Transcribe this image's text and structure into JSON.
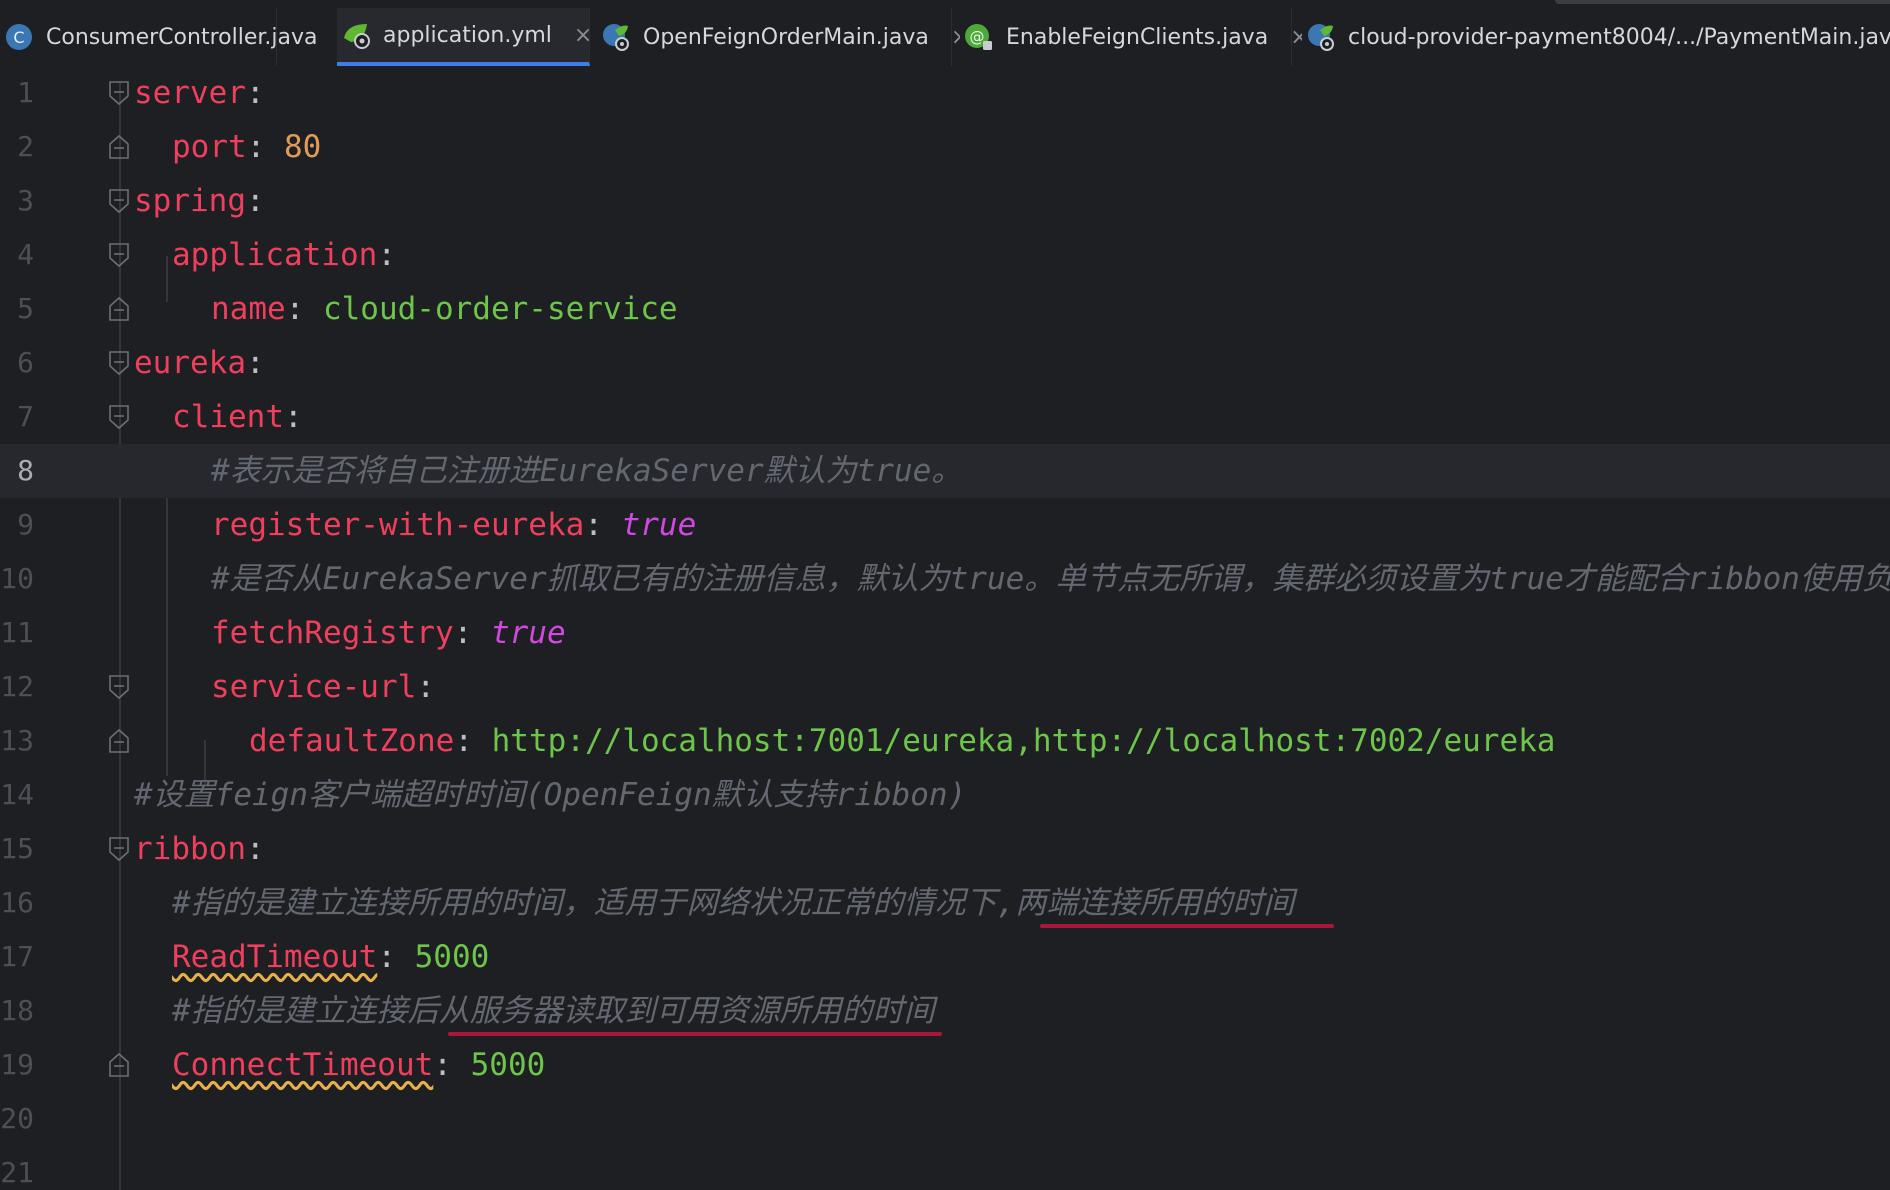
{
  "tabs": [
    {
      "label": "ConsumerController.java",
      "icon": "java-class-icon",
      "active": false
    },
    {
      "label": "application.yml",
      "icon": "spring-config-icon",
      "active": true
    },
    {
      "label": "OpenFeignOrderMain.java",
      "icon": "spring-boot-class-icon",
      "active": false
    },
    {
      "label": "EnableFeignClients.java",
      "icon": "annotation-icon",
      "active": false
    },
    {
      "label": "cloud-provider-payment8004/.../PaymentMain.java",
      "icon": "spring-boot-class-icon",
      "active": false
    }
  ],
  "close_glyph": "×",
  "colors": {
    "key": "#ee3f5c",
    "string": "#6dc54a",
    "number": "#e09a5c",
    "boolean": "#d048e0",
    "comment": "#636770",
    "active_tab_underline": "#3d7ee8",
    "highlight_underline": "#a8163a"
  },
  "editor": {
    "current_line": 8,
    "line_numbers": [
      "1",
      "2",
      "3",
      "4",
      "5",
      "6",
      "7",
      "8",
      "9",
      "10",
      "11",
      "12",
      "13",
      "14",
      "15",
      "16",
      "17",
      "18",
      "19",
      "20",
      "21"
    ],
    "lines": {
      "l1": {
        "key": "server",
        "sep": ":"
      },
      "l2": {
        "key": "port",
        "sep": ": ",
        "value": "80"
      },
      "l3": {
        "key": "spring",
        "sep": ":"
      },
      "l4": {
        "key": "application",
        "sep": ":"
      },
      "l5": {
        "key": "name",
        "sep": ": ",
        "value": "cloud-order-service"
      },
      "l6": {
        "key": "eureka",
        "sep": ":"
      },
      "l7": {
        "key": "client",
        "sep": ":"
      },
      "l8": {
        "comment": "#表示是否将自己注册进EurekaServer默认为true。"
      },
      "l9": {
        "key": "register-with-eureka",
        "sep": ": ",
        "value": "true"
      },
      "l10": {
        "comment": "#是否从EurekaServer抓取已有的注册信息，默认为true。单节点无所谓，集群必须设置为true才能配合ribbon使用负载均衡"
      },
      "l11": {
        "key": "fetchRegistry",
        "sep": ": ",
        "value": "true"
      },
      "l12": {
        "key": "service-url",
        "sep": ":"
      },
      "l13": {
        "key": "defaultZone",
        "sep": ": ",
        "value": "http://localhost:7001/eureka,http://localhost:7002/eureka"
      },
      "l14": {
        "comment": "#设置feign客户端超时时间(OpenFeign默认支持ribbon)"
      },
      "l15": {
        "key": "ribbon",
        "sep": ":"
      },
      "l16": {
        "comment": "#指的是建立连接所用的时间，适用于网络状况正常的情况下,两端连接所用的时间"
      },
      "l17": {
        "key": "ReadTimeout",
        "sep": ": ",
        "value": "5000"
      },
      "l18": {
        "comment": "#指的是建立连接后从服务器读取到可用资源所用的时间"
      },
      "l19": {
        "key": "ConnectTimeout",
        "sep": ": ",
        "value": "5000"
      }
    }
  }
}
